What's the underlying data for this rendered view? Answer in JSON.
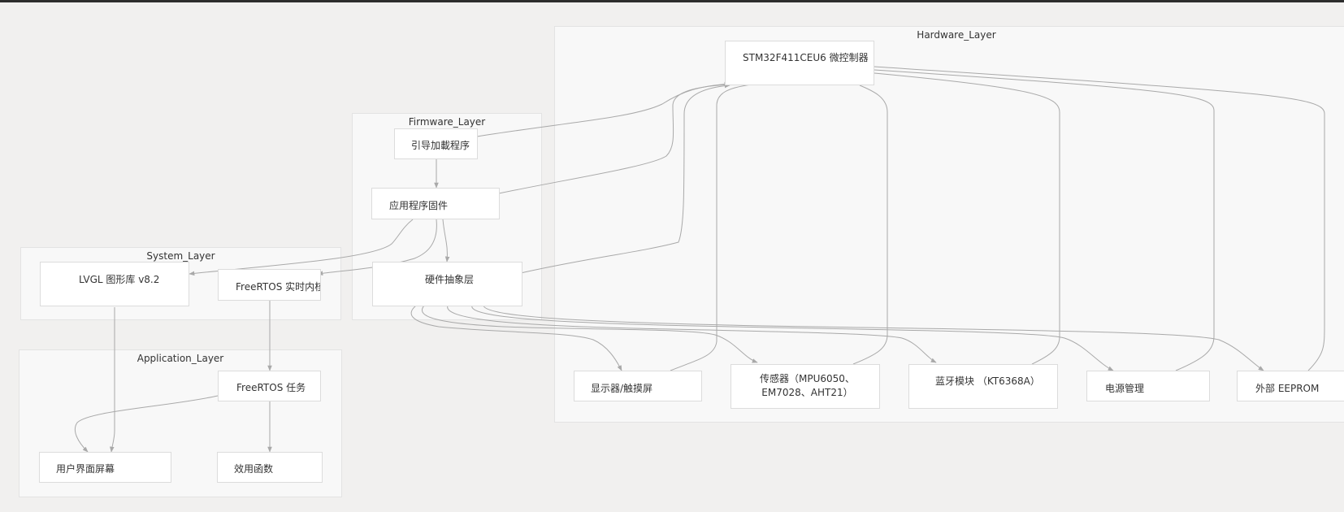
{
  "groups": {
    "hardware": "Hardware_Layer",
    "firmware": "Firmware_Layer",
    "system": "System_Layer",
    "application": "Application_Layer"
  },
  "nodes": {
    "mcu": "STM32F411CEU6 微控制器",
    "bootloader": "引导加載程序",
    "app_firmware": "应用程序固件",
    "hal": "硬件抽象层",
    "lvgl": "LVGL 图形库 v8.2",
    "freertos_rt": "FreeRTOS 实时内核",
    "freertos_task": "FreeRTOS 任务",
    "ui_screen": "用户界面屏幕",
    "utility": "效用函数",
    "display": "显示器/触摸屏",
    "sensors": "传感器（MPU6050、\nEM7028、AHT21）",
    "bluetooth": "蓝牙模块 （KT6368A）",
    "power": "电源管理",
    "eeprom": "外部 EEPROM"
  },
  "colors": {
    "background": "#f1f0ef",
    "group_fill": "#f8f8f8",
    "node_fill": "#ffffff",
    "edge": "#a9a9a9"
  }
}
